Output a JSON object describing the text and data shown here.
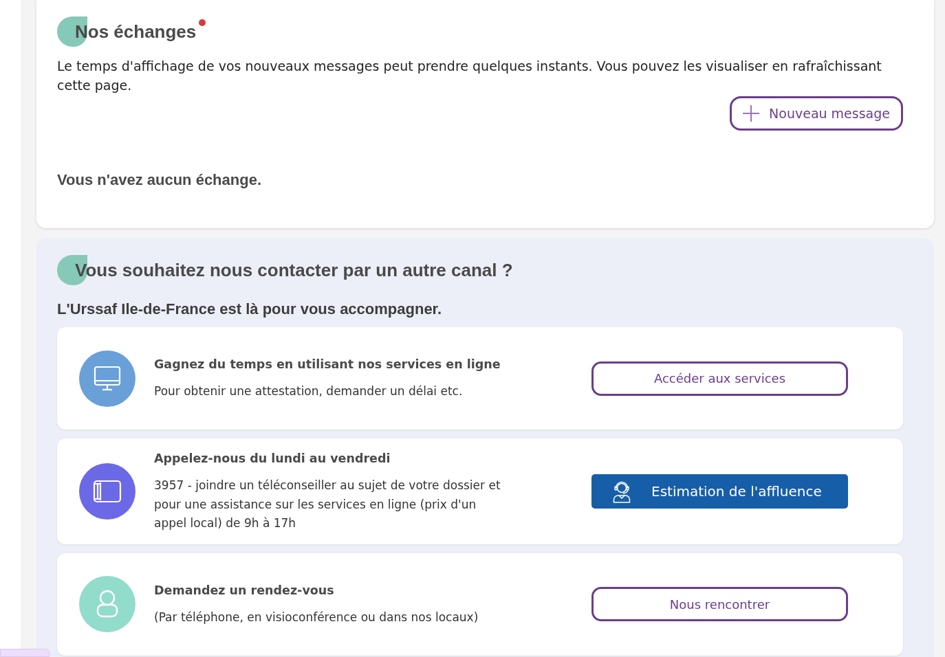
{
  "messages": {
    "title": "Nos échanges",
    "unread_dot": true,
    "info": "Le temps d'affichage de vos nouveaux messages peut prendre quelques instants. Vous pouvez les visualiser en rafraîchissant cette page.",
    "new_message_button": {
      "label": "Nouveau message"
    },
    "empty_state": "Vous n'avez aucun échange."
  },
  "contact": {
    "title": "Vous souhaitez nous contacter par un autre canal ?",
    "subtitle": "L'Urssaf Ile-de-France est là pour vous accompagner.",
    "channels": [
      {
        "kind": "online",
        "color": "#69a0d8",
        "title": "Gagnez du temps en utilisant nos services en ligne",
        "description": "Pour obtenir une attestation, demander un délai etc.",
        "button": {
          "kind": "outline",
          "label": "Accéder aux services"
        }
      },
      {
        "kind": "phone",
        "color": "#6c69e6",
        "title": "Appelez-nous du lundi au vendredi",
        "description": "3957 - joindre un téléconseiller au sujet de votre dossier et pour une assistance sur les services en ligne (prix d'un appel local) de 9h à 17h",
        "button": {
          "kind": "filled",
          "label": "Estimation de l'affluence"
        }
      },
      {
        "kind": "meeting",
        "color": "#92dccb",
        "title": "Demandez un rendez-vous",
        "description": "(Par téléphone, en visioconférence ou dans nos locaux)",
        "button": {
          "kind": "outline",
          "label": "Nous rencontrer"
        }
      }
    ]
  }
}
